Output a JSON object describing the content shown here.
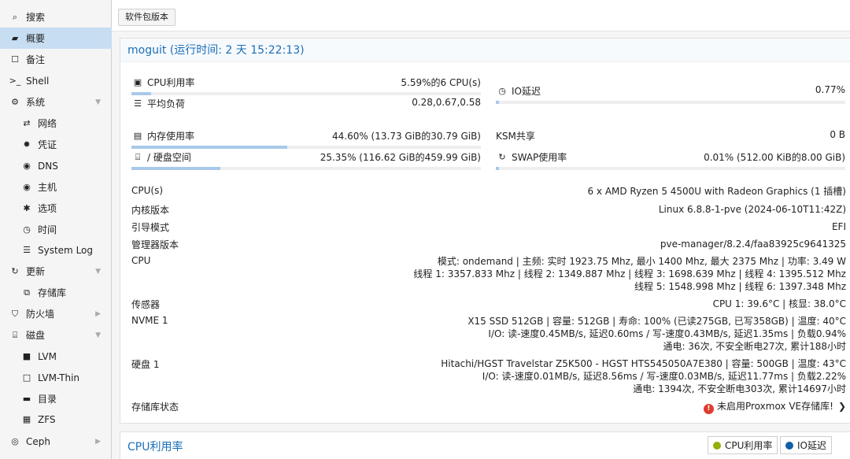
{
  "sidebar": {
    "items": [
      {
        "label": "搜索",
        "icon": "search-icon",
        "glyph": "⌕"
      },
      {
        "label": "概要",
        "icon": "book-icon",
        "glyph": "▰"
      },
      {
        "label": "备注",
        "icon": "note-icon",
        "glyph": "☐"
      },
      {
        "label": "Shell",
        "icon": "terminal-icon",
        "glyph": ">_"
      },
      {
        "label": "系统",
        "icon": "cogs-icon",
        "glyph": "⚙"
      },
      {
        "label": "网络",
        "icon": "exchange-icon",
        "glyph": "⇄"
      },
      {
        "label": "凭证",
        "icon": "certificate-icon",
        "glyph": "✹"
      },
      {
        "label": "DNS",
        "icon": "globe-icon",
        "glyph": "◉"
      },
      {
        "label": "主机",
        "icon": "globe-icon",
        "glyph": "◉"
      },
      {
        "label": "选项",
        "icon": "gear-icon",
        "glyph": "✱"
      },
      {
        "label": "时间",
        "icon": "clock-icon",
        "glyph": "◷"
      },
      {
        "label": "System Log",
        "icon": "list-icon",
        "glyph": "☰"
      },
      {
        "label": "更新",
        "icon": "refresh-icon",
        "glyph": "↻"
      },
      {
        "label": "存储库",
        "icon": "copy-icon",
        "glyph": "⧉"
      },
      {
        "label": "防火墙",
        "icon": "shield-icon",
        "glyph": "⛉"
      },
      {
        "label": "磁盘",
        "icon": "hdd-icon",
        "glyph": "⌸"
      },
      {
        "label": "LVM",
        "icon": "square-icon",
        "glyph": "■"
      },
      {
        "label": "LVM-Thin",
        "icon": "square-outline-icon",
        "glyph": "□"
      },
      {
        "label": "目录",
        "icon": "folder-icon",
        "glyph": "▬"
      },
      {
        "label": "ZFS",
        "icon": "th-large-icon",
        "glyph": "▦"
      },
      {
        "label": "Ceph",
        "icon": "ceph-icon",
        "glyph": "◎"
      }
    ]
  },
  "toolbar": {
    "package_versions_label": "软件包版本"
  },
  "summary": {
    "title": "moguit (运行时间: 2 天 15:22:13)",
    "cpu": {
      "label": "CPU利用率",
      "value": "5.59%的6 CPU(s)",
      "fraction": 0.0559
    },
    "io_delay": {
      "label": "IO延迟",
      "value": "0.77%",
      "fraction": 0.0077
    },
    "load": {
      "label": "平均负荷",
      "value": "0.28,0.67,0.58"
    },
    "memory": {
      "label": "内存使用率",
      "value": "44.60% (13.73 GiB的30.79 GiB)",
      "fraction": 0.446
    },
    "ksm": {
      "label": "KSM共享",
      "value": "0 B"
    },
    "disk": {
      "label": "/ 硬盘空间",
      "value": "25.35% (116.62 GiB的459.99 GiB)",
      "fraction": 0.2535
    },
    "swap": {
      "label": "SWAP使用率",
      "value": "0.01% (512.00 KiB的8.00 GiB)",
      "fraction": 0.0001
    },
    "info": [
      {
        "key": "CPU(s)",
        "lines": [
          "6 x AMD Ryzen 5 4500U with Radeon Graphics (1 插槽)"
        ]
      },
      {
        "key": "内核版本",
        "lines": [
          "Linux 6.8.8-1-pve (2024-06-10T11:42Z)"
        ]
      },
      {
        "key": "引导模式",
        "lines": [
          "EFI"
        ]
      },
      {
        "key": "管理器版本",
        "lines": [
          "pve-manager/8.2.4/faa83925c9641325"
        ]
      },
      {
        "key": "CPU",
        "lines": [
          "模式: ondemand | 主频: 实时 1923.75 Mhz, 最小 1400 Mhz, 最大 2375 Mhz | 功率: 3.49 W",
          "线程 1: 3357.833 Mhz | 线程 2: 1349.887 Mhz | 线程 3: 1698.639 Mhz | 线程 4: 1395.512 Mhz",
          "线程 5: 1548.998 Mhz | 线程 6: 1397.348 Mhz"
        ]
      },
      {
        "key": "传感器",
        "lines": [
          "CPU 1: 39.6°C | 核显: 38.0°C"
        ]
      },
      {
        "key": "NVME 1",
        "lines": [
          "X15 SSD 512GB | 容量: 512GB | 寿命: 100% (已读275GB, 已写358GB) | 温度: 40°C",
          "I/O: 读-速度0.45MB/s, 延迟0.60ms / 写-速度0.43MB/s, 延迟1.35ms | 负载0.94%",
          "通电: 36次, 不安全断电27次, 累计188小时"
        ]
      },
      {
        "key": "硬盘 1",
        "lines": [
          "Hitachi/HGST Travelstar Z5K500 - HGST HTS545050A7E380 | 容量: 500GB | 温度: 43°C",
          "I/O: 读-速度0.01MB/s, 延迟8.56ms / 写-速度0.03MB/s, 延迟11.77ms | 负载2.22%",
          "通电: 1394次, 不安全断电303次, 累计14697小时"
        ]
      },
      {
        "key": "存储库状态",
        "lines": [
          "未启用Proxmox VE存储库!"
        ]
      }
    ]
  },
  "cpu_chart": {
    "title": "CPU利用率",
    "legend": [
      {
        "label": "CPU利用率",
        "color": "#94ae0a"
      },
      {
        "label": "IO延迟",
        "color": "#115fa6"
      }
    ]
  }
}
